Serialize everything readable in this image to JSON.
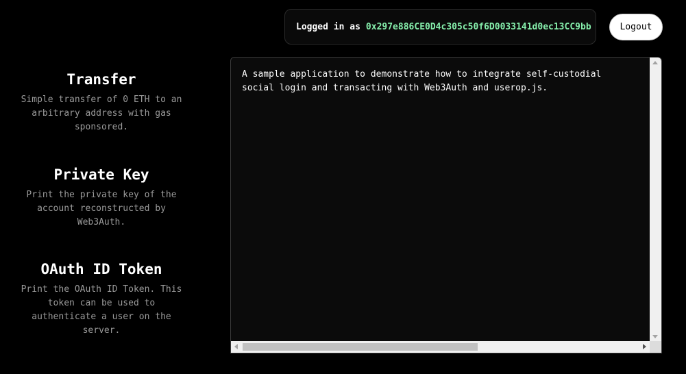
{
  "header": {
    "logged_in_prefix": "Logged in as",
    "address": "0x297e886CE0D4c305c50f6D0033141d0ec13CC9bb",
    "logout_label": "Logout"
  },
  "sidebar": {
    "items": [
      {
        "title": "Transfer",
        "description": "Simple transfer of 0 ETH to an arbitrary address with gas sponsored."
      },
      {
        "title": "Private Key",
        "description": "Print the private key of the account reconstructed by Web3Auth."
      },
      {
        "title": "OAuth ID Token",
        "description": "Print the OAuth ID Token. This token can be used to authenticate a user on the server."
      }
    ]
  },
  "output": {
    "text": "A sample application to demonstrate how to integrate self-custodial\nsocial login and transacting with Web3Auth and userop.js."
  },
  "colors": {
    "background": "#000000",
    "address": "#86efac",
    "muted_text": "#9a9a9a"
  }
}
